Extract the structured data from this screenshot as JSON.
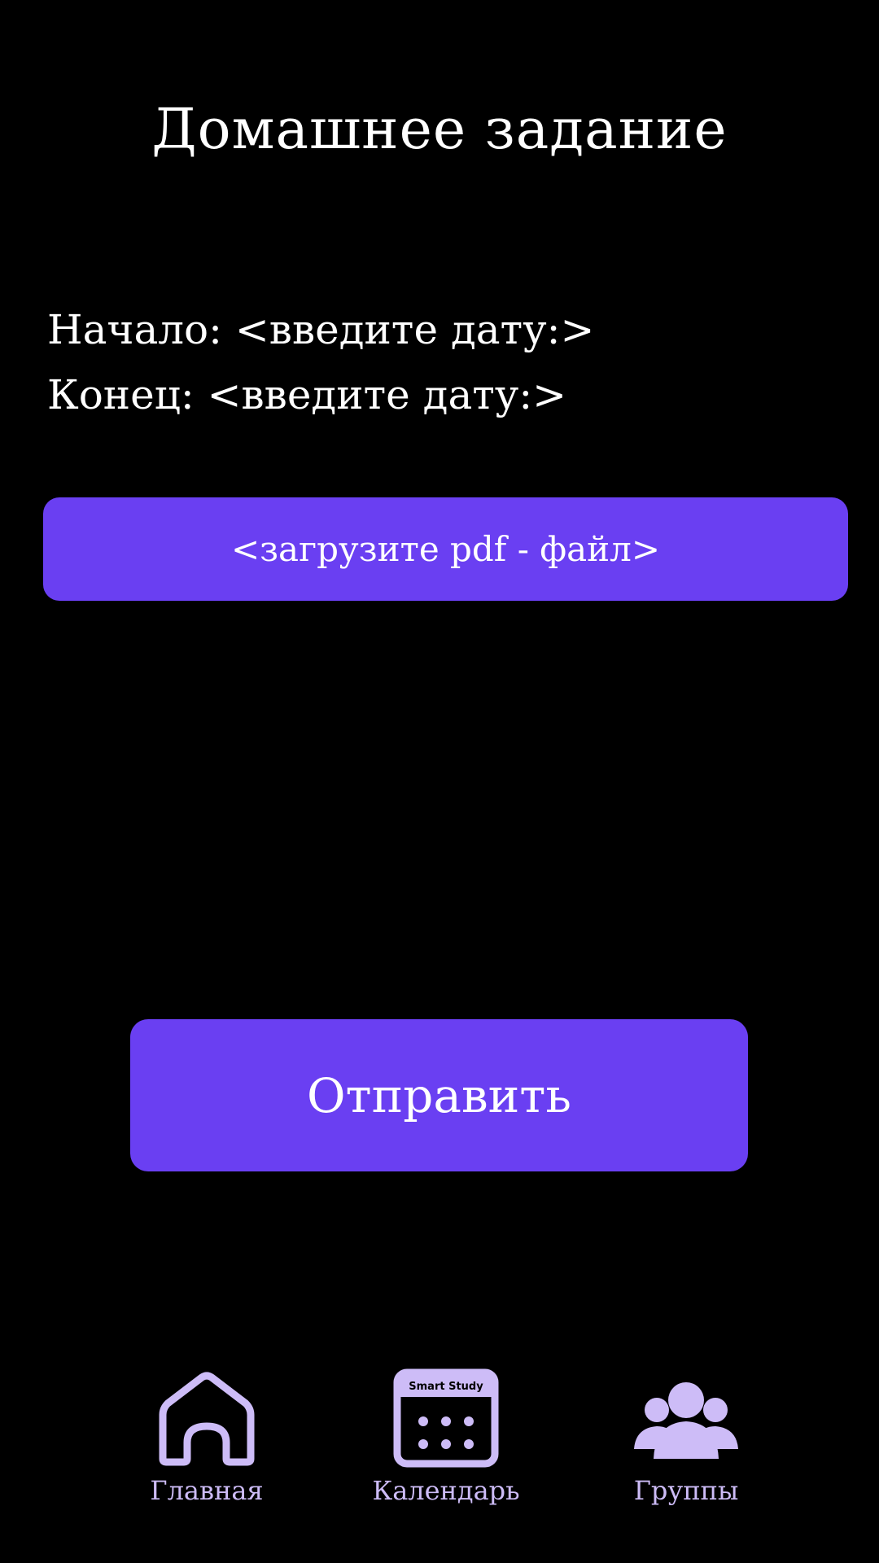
{
  "header": {
    "title": "Домашнее задание"
  },
  "form": {
    "start_label": "Начало:",
    "start_value": "<введите дату:>",
    "end_label": "Конец:",
    "end_value": "<введите дату:>",
    "upload_label": "<загрузите pdf - файл>",
    "submit_label": "Отправить"
  },
  "bottom_nav": {
    "items": [
      {
        "label": "Главная",
        "icon": "home-icon"
      },
      {
        "label": "Календарь",
        "icon": "calendar-icon",
        "icon_caption": "Smart Study"
      },
      {
        "label": "Группы",
        "icon": "groups-icon"
      }
    ]
  },
  "colors": {
    "background": "#000000",
    "accent": "#6a3ff2",
    "nav_icon": "#cdbcf7",
    "text": "#ffffff"
  }
}
